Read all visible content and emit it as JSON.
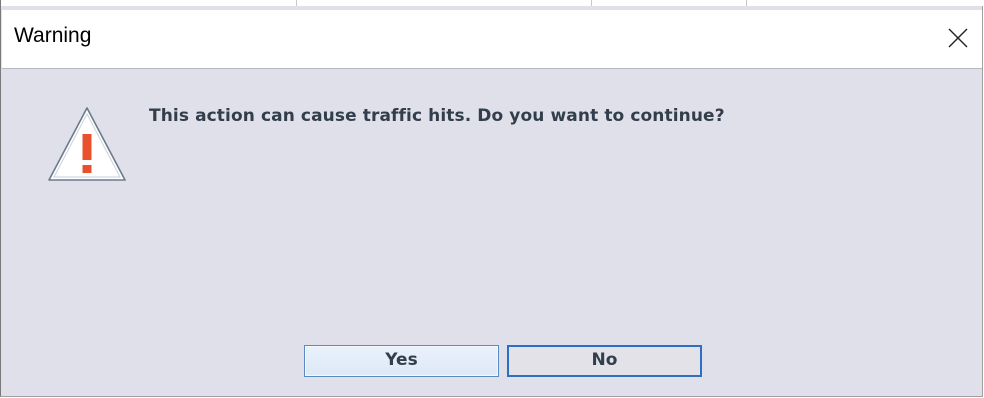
{
  "window": {
    "title": "Warning",
    "close_icon": "close-icon"
  },
  "dialog": {
    "icon": "warning-triangle-icon",
    "message": "This action can cause traffic hits.  Do you want to continue?"
  },
  "buttons": {
    "yes_label": "Yes",
    "no_label": "No"
  },
  "colors": {
    "content_bg": "#e0e0ea",
    "text": "#333e4c",
    "focus_border": "#2d6fc0",
    "icon_exclamation": "#e8502e"
  }
}
